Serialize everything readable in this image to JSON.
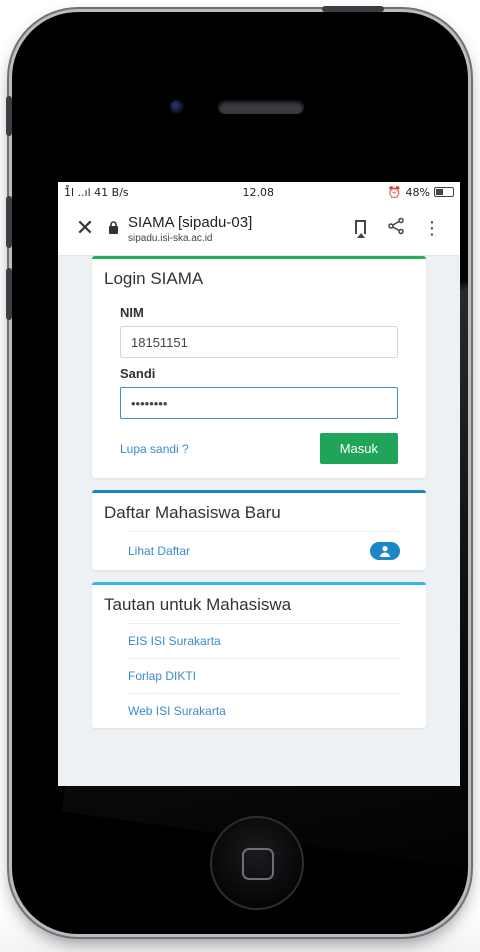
{
  "status": {
    "left": "1̊l ..ıl 41 B/s",
    "time": "12.08",
    "right": "48%"
  },
  "browser": {
    "title": "SIAMA [sipadu-03]",
    "url": "sipadu.isi-ska.ac.id",
    "icons": [
      "close-icon",
      "lock-icon",
      "bookmark-icon",
      "share-icon",
      "more-icon"
    ]
  },
  "login": {
    "title": "Login SIAMA",
    "nim_label": "NIM",
    "nim_value": "18151151",
    "sandi_label": "Sandi",
    "sandi_value": "••••••••",
    "forgot_link": "Lupa sandi ?",
    "submit_label": "Masuk"
  },
  "daftar": {
    "title": "Daftar Mahasiswa Baru",
    "link": "Lihat Daftar"
  },
  "tautan": {
    "title": "Tautan untuk Mahasiswa",
    "links": [
      "EIS ISI Surakarta",
      "Forlap DIKTI",
      "Web ISI Surakarta"
    ]
  },
  "colors": {
    "green_accent": "#20b05c",
    "blue_accent": "#1d86c8",
    "cyan_accent": "#35b4e4",
    "link": "#3a8ad0"
  }
}
